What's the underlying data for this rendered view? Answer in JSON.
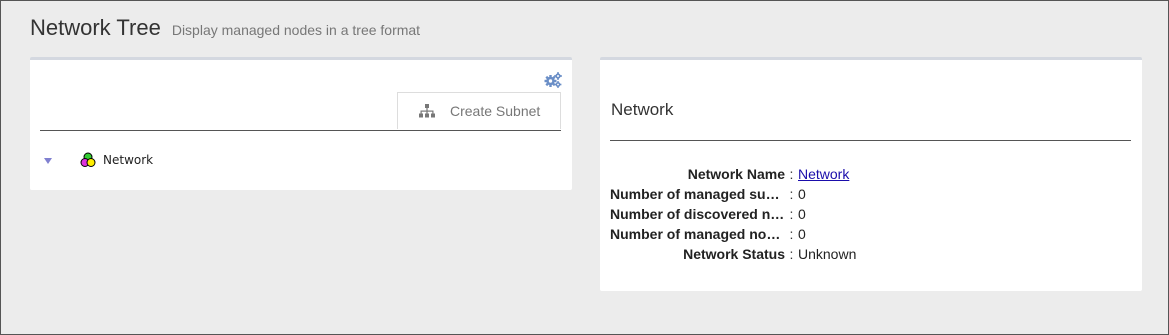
{
  "header": {
    "title": "Network Tree",
    "subtitle": "Display managed nodes in a tree format"
  },
  "left_panel": {
    "settings_icon": "gears-icon",
    "create_subnet_label": "Create Subnet",
    "create_subnet_icon": "sitemap-icon",
    "tree": {
      "toggle_icon": "triangle-down-icon",
      "node_icon": "network-circles-icon",
      "node_label": "Network"
    }
  },
  "right_panel": {
    "title": "Network",
    "details": [
      {
        "key": "Network Name",
        "value": "Network",
        "link": true
      },
      {
        "key": "Number of managed subnets",
        "value": "0",
        "link": false
      },
      {
        "key": "Number of discovered nodes",
        "value": "0",
        "link": false
      },
      {
        "key": "Number of managed nodes",
        "value": "0",
        "link": false
      },
      {
        "key": "Network Status",
        "value": "Unknown",
        "link": false
      }
    ],
    "separator": ":"
  },
  "colors": {
    "background": "#ececec",
    "panel": "#ffffff",
    "accent_icon": "#6b8fc7",
    "link": "#1a0dab",
    "toggle": "#8080d0"
  }
}
